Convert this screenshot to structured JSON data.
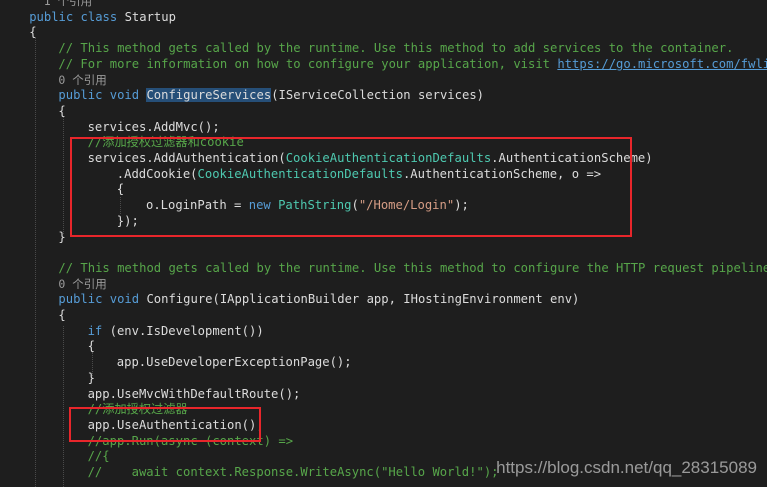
{
  "code_lines": [
    {
      "kind": "ref",
      "indent": 6,
      "text": "1 个引用"
    },
    {
      "kind": "code",
      "indent": 4,
      "tokens": [
        {
          "t": "public class ",
          "c": "keyword"
        },
        {
          "t": "Startup",
          "c": "plain"
        }
      ]
    },
    {
      "kind": "code",
      "indent": 4,
      "tokens": [
        {
          "t": "{",
          "c": "plain"
        }
      ]
    },
    {
      "kind": "code",
      "indent": 8,
      "tokens": [
        {
          "t": "// This method gets called by the runtime. Use this method to add services to the container.",
          "c": "comment"
        }
      ]
    },
    {
      "kind": "code",
      "indent": 8,
      "tokens": [
        {
          "t": "// For more information on how to configure your application, visit ",
          "c": "comment"
        },
        {
          "t": "https://go.microsoft.com/fwlink/?L",
          "c": "link"
        }
      ]
    },
    {
      "kind": "ref",
      "indent": 8,
      "text": "0 个引用"
    },
    {
      "kind": "code",
      "indent": 8,
      "tokens": [
        {
          "t": "public void ",
          "c": "keyword"
        },
        {
          "t": "ConfigureServices",
          "c": "hl"
        },
        {
          "t": "(IServiceCollection services)",
          "c": "plain"
        }
      ]
    },
    {
      "kind": "code",
      "indent": 8,
      "tokens": [
        {
          "t": "{",
          "c": "plain"
        }
      ]
    },
    {
      "kind": "code",
      "indent": 12,
      "tokens": [
        {
          "t": "services.AddMvc();",
          "c": "plain"
        }
      ]
    },
    {
      "kind": "code",
      "indent": 12,
      "tokens": [
        {
          "t": "//添加授权过滤器和cookie",
          "c": "comment"
        }
      ]
    },
    {
      "kind": "code",
      "indent": 12,
      "tokens": [
        {
          "t": "services.AddAuthentication(",
          "c": "plain"
        },
        {
          "t": "CookieAuthenticationDefaults",
          "c": "type"
        },
        {
          "t": ".AuthenticationScheme)",
          "c": "plain"
        }
      ]
    },
    {
      "kind": "code",
      "indent": 16,
      "tokens": [
        {
          "t": ".AddCookie(",
          "c": "plain"
        },
        {
          "t": "CookieAuthenticationDefaults",
          "c": "type"
        },
        {
          "t": ".AuthenticationScheme, o =>",
          "c": "plain"
        }
      ]
    },
    {
      "kind": "code",
      "indent": 16,
      "tokens": [
        {
          "t": "{",
          "c": "plain"
        }
      ]
    },
    {
      "kind": "code",
      "indent": 20,
      "tokens": [
        {
          "t": "o.LoginPath = ",
          "c": "plain"
        },
        {
          "t": "new ",
          "c": "keyword"
        },
        {
          "t": "PathString",
          "c": "type"
        },
        {
          "t": "(",
          "c": "plain"
        },
        {
          "t": "\"/Home/Login\"",
          "c": "string"
        },
        {
          "t": ");",
          "c": "plain"
        }
      ]
    },
    {
      "kind": "code",
      "indent": 16,
      "tokens": [
        {
          "t": "});",
          "c": "plain"
        }
      ]
    },
    {
      "kind": "code",
      "indent": 8,
      "tokens": [
        {
          "t": "}",
          "c": "plain"
        }
      ]
    },
    {
      "kind": "blank"
    },
    {
      "kind": "code",
      "indent": 8,
      "tokens": [
        {
          "t": "// This method gets called by the runtime. Use this method to configure the HTTP request pipeline.",
          "c": "comment"
        }
      ]
    },
    {
      "kind": "ref",
      "indent": 8,
      "text": "0 个引用"
    },
    {
      "kind": "code",
      "indent": 8,
      "tokens": [
        {
          "t": "public void ",
          "c": "keyword"
        },
        {
          "t": "Configure(IApplicationBuilder app, IHostingEnvironment env)",
          "c": "plain"
        }
      ]
    },
    {
      "kind": "code",
      "indent": 8,
      "tokens": [
        {
          "t": "{",
          "c": "plain"
        }
      ]
    },
    {
      "kind": "code",
      "indent": 12,
      "tokens": [
        {
          "t": "if ",
          "c": "keyword"
        },
        {
          "t": "(env.IsDevelopment())",
          "c": "plain"
        }
      ]
    },
    {
      "kind": "code",
      "indent": 12,
      "tokens": [
        {
          "t": "{",
          "c": "plain"
        }
      ]
    },
    {
      "kind": "code",
      "indent": 16,
      "tokens": [
        {
          "t": "app.UseDeveloperExceptionPage();",
          "c": "plain"
        }
      ]
    },
    {
      "kind": "code",
      "indent": 12,
      "tokens": [
        {
          "t": "}",
          "c": "plain"
        }
      ]
    },
    {
      "kind": "code",
      "indent": 12,
      "tokens": [
        {
          "t": "app.UseMvcWithDefaultRoute();",
          "c": "plain"
        }
      ]
    },
    {
      "kind": "code",
      "indent": 12,
      "tokens": [
        {
          "t": "//添加授权过滤器",
          "c": "comment"
        }
      ]
    },
    {
      "kind": "code",
      "indent": 12,
      "tokens": [
        {
          "t": "app.UseAuthentication();",
          "c": "plain"
        }
      ]
    },
    {
      "kind": "code",
      "indent": 12,
      "tokens": [
        {
          "t": "//app.Run(async (context) =>",
          "c": "comment"
        }
      ]
    },
    {
      "kind": "code",
      "indent": 12,
      "tokens": [
        {
          "t": "//{",
          "c": "comment"
        }
      ]
    },
    {
      "kind": "code",
      "indent": 12,
      "tokens": [
        {
          "t": "//    await context.Response.WriteAsync(\"Hello World!\");",
          "c": "comment"
        }
      ]
    }
  ],
  "watermark": "https://blog.csdn.net/qq_28315089",
  "colors": {
    "background": "#1e1e1e",
    "keyword": "#569cd6",
    "type": "#4ec9b0",
    "comment": "#57a64a",
    "string": "#d69d85",
    "plain": "#dcdcdc",
    "highlight": "#264f78",
    "annotation_box": "#e8262b"
  }
}
